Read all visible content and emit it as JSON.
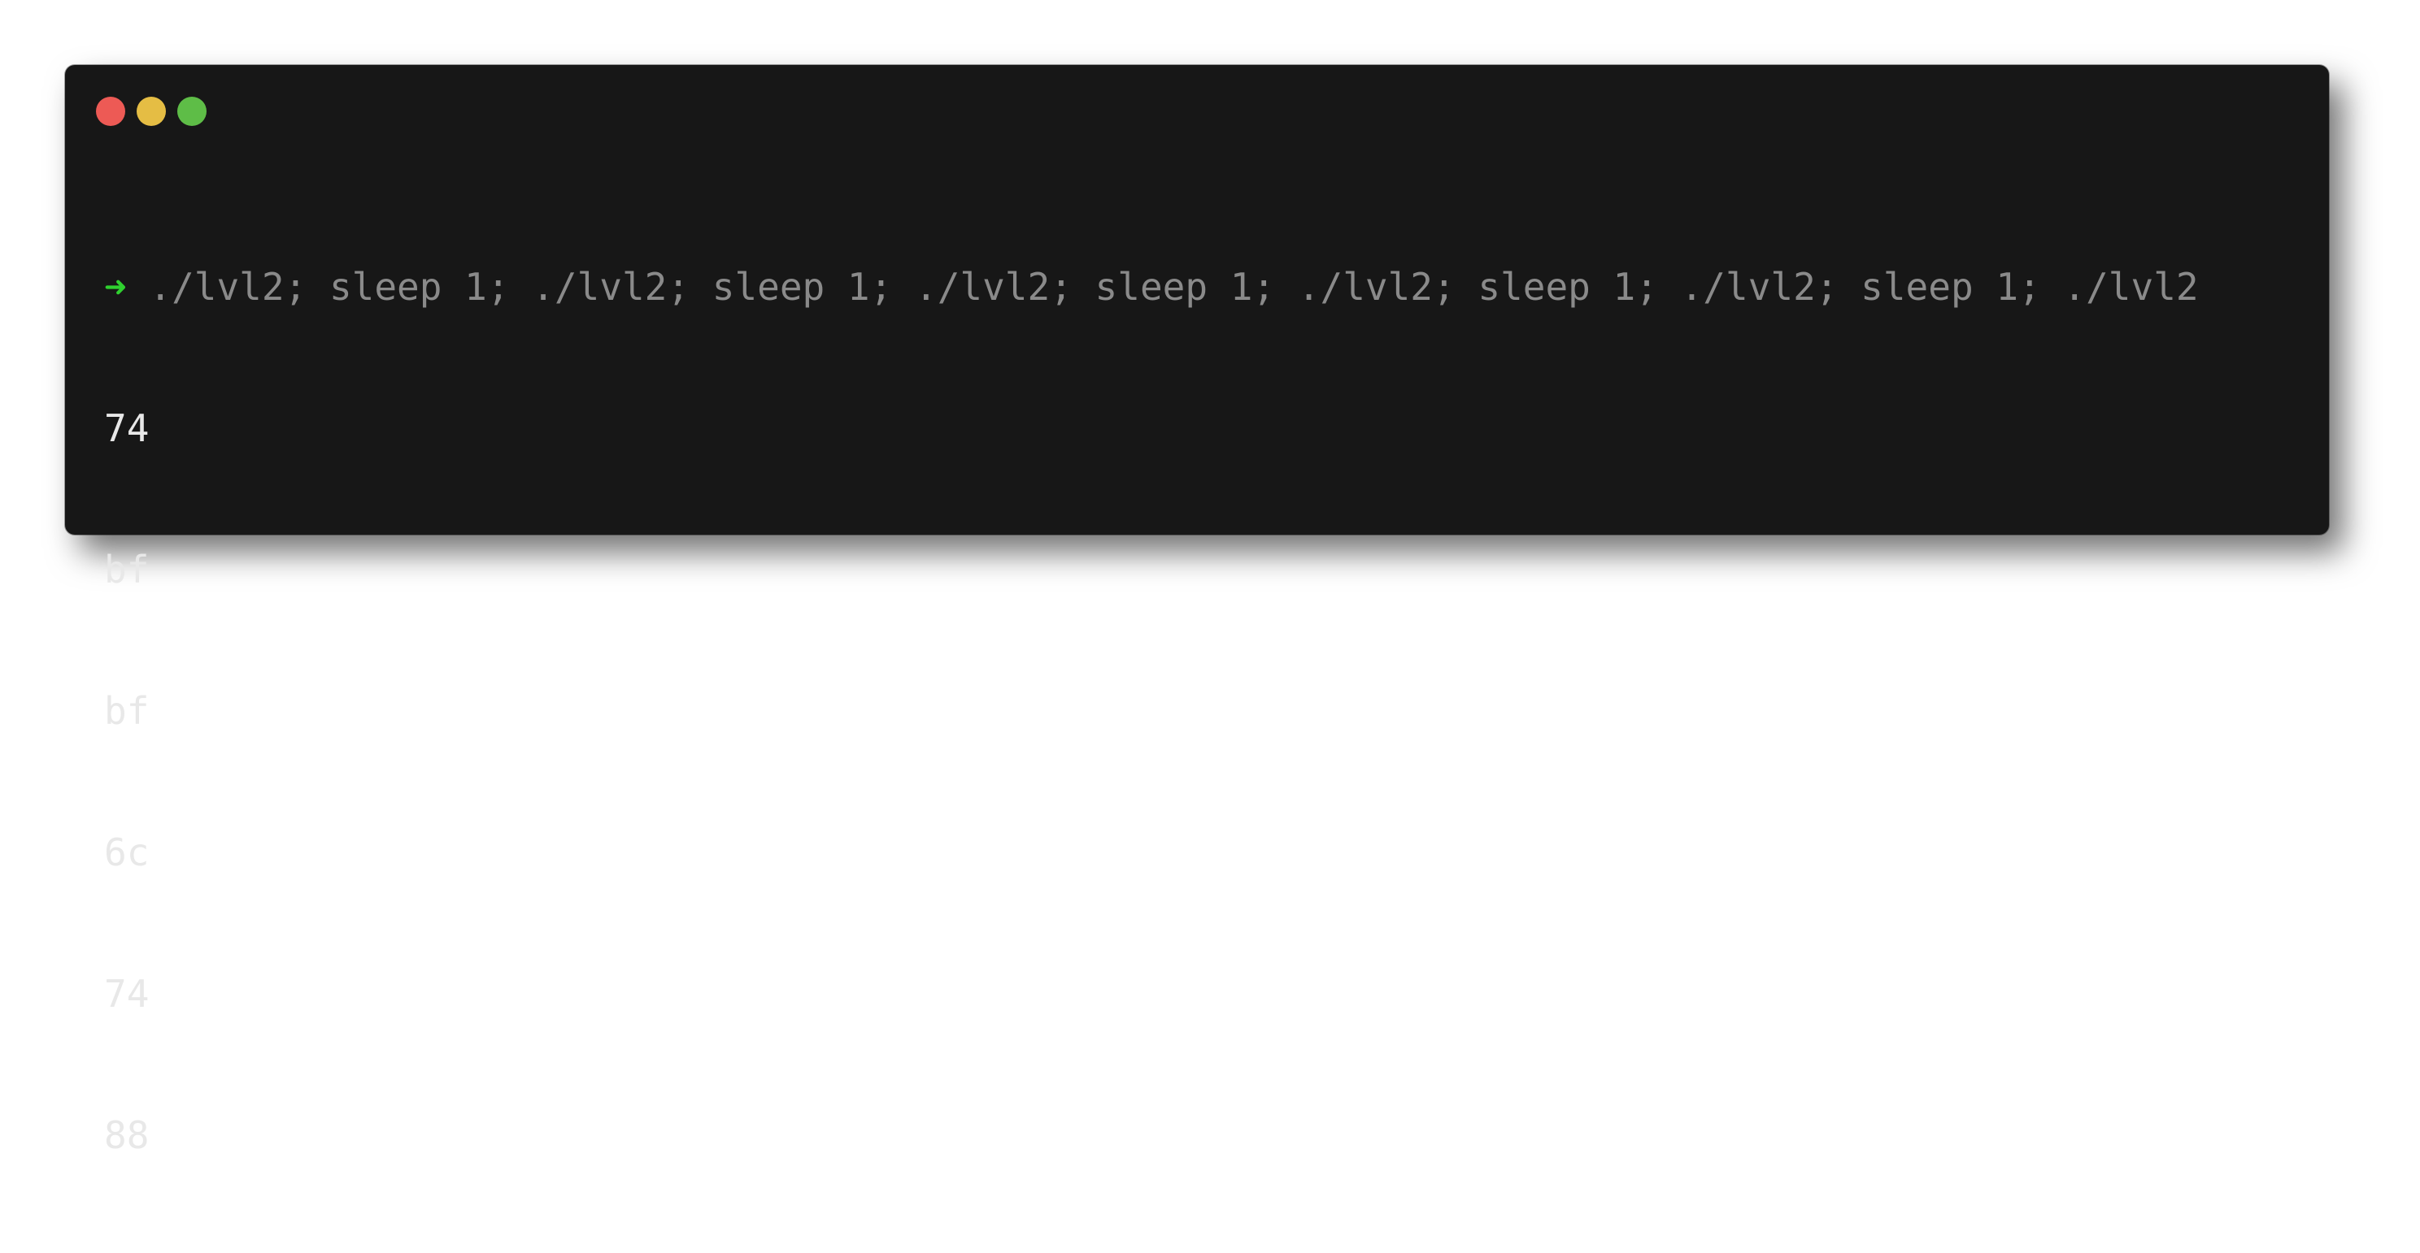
{
  "window": {
    "buttons": {
      "close_color": "#ed5a55",
      "minimize_color": "#e5bd44",
      "zoom_color": "#5ebd47"
    }
  },
  "terminal": {
    "prompt_symbol": "➜",
    "command": " ./lvl2; sleep 1; ./lvl2; sleep 1; ./lvl2; sleep 1; ./lvl2; sleep 1; ./lvl2; sleep 1; ./lvl2",
    "output": [
      "74",
      "bf",
      "bf",
      "6c",
      "74",
      "88"
    ]
  }
}
